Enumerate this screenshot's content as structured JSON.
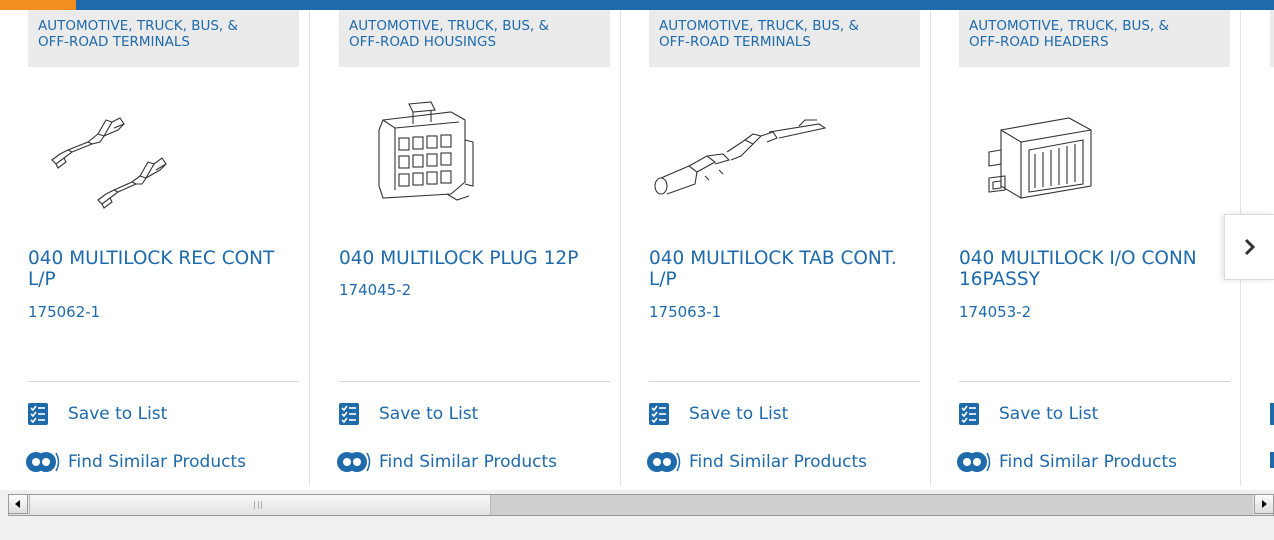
{
  "products": [
    {
      "category_line1": "AUTOMOTIVE, TRUCK, BUS, &",
      "category_line2": "OFF-ROAD TERMINALS",
      "name": "040 MULTILOCK REC CONT L/P",
      "part_number": "175062-1",
      "image_icon": "terminal-pair-image"
    },
    {
      "category_line1": "AUTOMOTIVE, TRUCK, BUS, &",
      "category_line2": "OFF-ROAD HOUSINGS",
      "name": "040 MULTILOCK PLUG 12P",
      "part_number": "174045-2",
      "image_icon": "plug-housing-image"
    },
    {
      "category_line1": "AUTOMOTIVE, TRUCK, BUS, &",
      "category_line2": "OFF-ROAD TERMINALS",
      "name": "040 MULTILOCK TAB CONT. L/P",
      "part_number": "175063-1",
      "image_icon": "tab-terminal-image"
    },
    {
      "category_line1": "AUTOMOTIVE, TRUCK, BUS, &",
      "category_line2": "OFF-ROAD HEADERS",
      "name": "040 MULTILOCK I/O CONN 16PASSY",
      "part_number": "174053-2",
      "image_icon": "header-connector-image"
    }
  ],
  "actions": {
    "save_label": "Save to List",
    "similar_label": "Find Similar Products"
  },
  "carousel": {
    "next_icon": "chevron-right-icon"
  },
  "colors": {
    "brand_blue": "#1e6aab",
    "accent_orange": "#f28d1f",
    "category_bg": "#ebebeb"
  }
}
